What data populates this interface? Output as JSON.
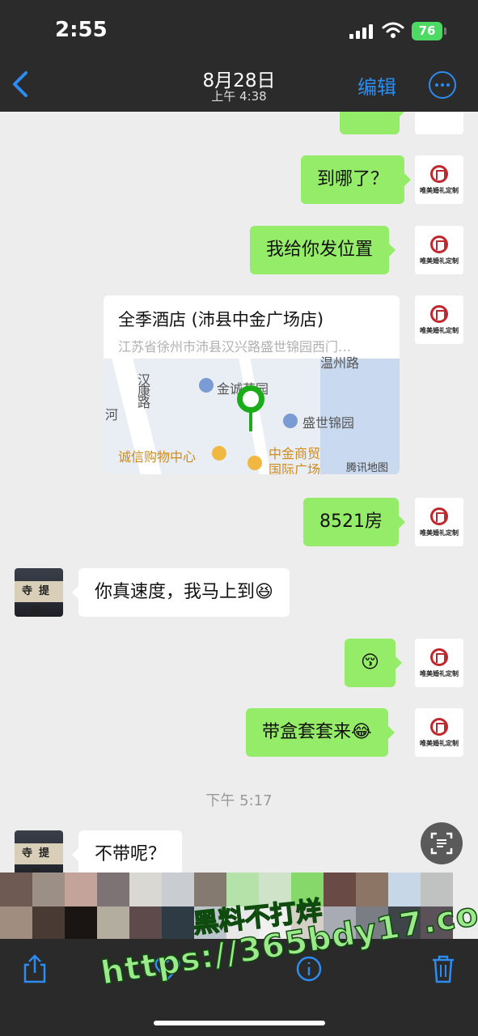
{
  "status": {
    "time": "2:55",
    "battery": "76"
  },
  "header": {
    "date": "8月28日",
    "time": "上午 4:38",
    "edit_label": "编辑"
  },
  "avatar_me_brand": "唯美婚礼定制",
  "avatar_them_plaque": "寺提菩",
  "messages": {
    "m1": "到哪了？",
    "m2": "我给你发位置",
    "m3": "8521房",
    "m4": "你真速度，我马上到😆",
    "m5": "😚",
    "m6": "带盒套套来😂",
    "m7": "不带呢？"
  },
  "location": {
    "title": "全季酒店 (沛县中金广场店)",
    "address": "江苏省徐州市沛县汉兴路盛世锦园西门…",
    "map_labels": {
      "road1": "汉康路",
      "river": "河",
      "poi1": "金诚苑园",
      "poi2": "盛世锦园",
      "poi3": "诚信购物中心",
      "poi4": "中金商贸",
      "poi4b": "国际广场",
      "road2": "温州路",
      "provider": "腾讯地图"
    }
  },
  "timestamp": "下午 5:17",
  "watermark": {
    "line1": "黑料不打烊",
    "line2": "https://365bdy17.com"
  },
  "colors": {
    "my_bubble": "#95ec69",
    "their_bubble": "#ffffff",
    "accent": "#2d8cf0",
    "map_pin": "#1aad19"
  }
}
